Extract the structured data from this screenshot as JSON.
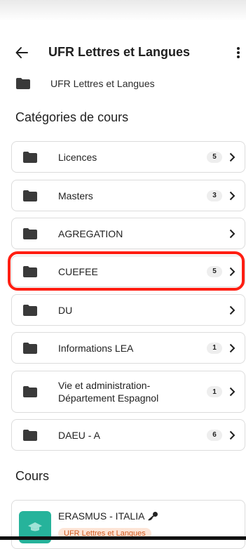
{
  "appbar": {
    "title": "UFR Lettres et Langues"
  },
  "breadcrumb": {
    "label": "UFR Lettres et Langues"
  },
  "sections": {
    "categories": "Catégories de cours",
    "courses": "Cours"
  },
  "categories": [
    {
      "label": "Licences",
      "count": "5"
    },
    {
      "label": "Masters",
      "count": "3"
    },
    {
      "label": "AGREGATION",
      "count": ""
    },
    {
      "label": "CUEFEE",
      "count": "5"
    },
    {
      "label": "DU",
      "count": ""
    },
    {
      "label": "Informations LEA",
      "count": "1"
    },
    {
      "label": "Vie et administration-\nDépartement Espagnol",
      "count": "1"
    },
    {
      "label": "DAEU - A",
      "count": "6"
    }
  ],
  "courses": [
    {
      "name": "ERASMUS - ITALIA",
      "tag": "UFR Lettres et Langues",
      "icon": "key-icon",
      "thumb_icon": "graduation-cap-icon"
    }
  ],
  "colors": {
    "accent": "#26b39b",
    "highlight": "#ff1e12",
    "tag_bg": "#fde5d7",
    "tag_text": "#d25a1f"
  },
  "icons": {
    "back": "arrow-left-icon",
    "more": "more-vertical-icon",
    "folder": "folder-icon",
    "chevron": "chevron-right-icon"
  }
}
